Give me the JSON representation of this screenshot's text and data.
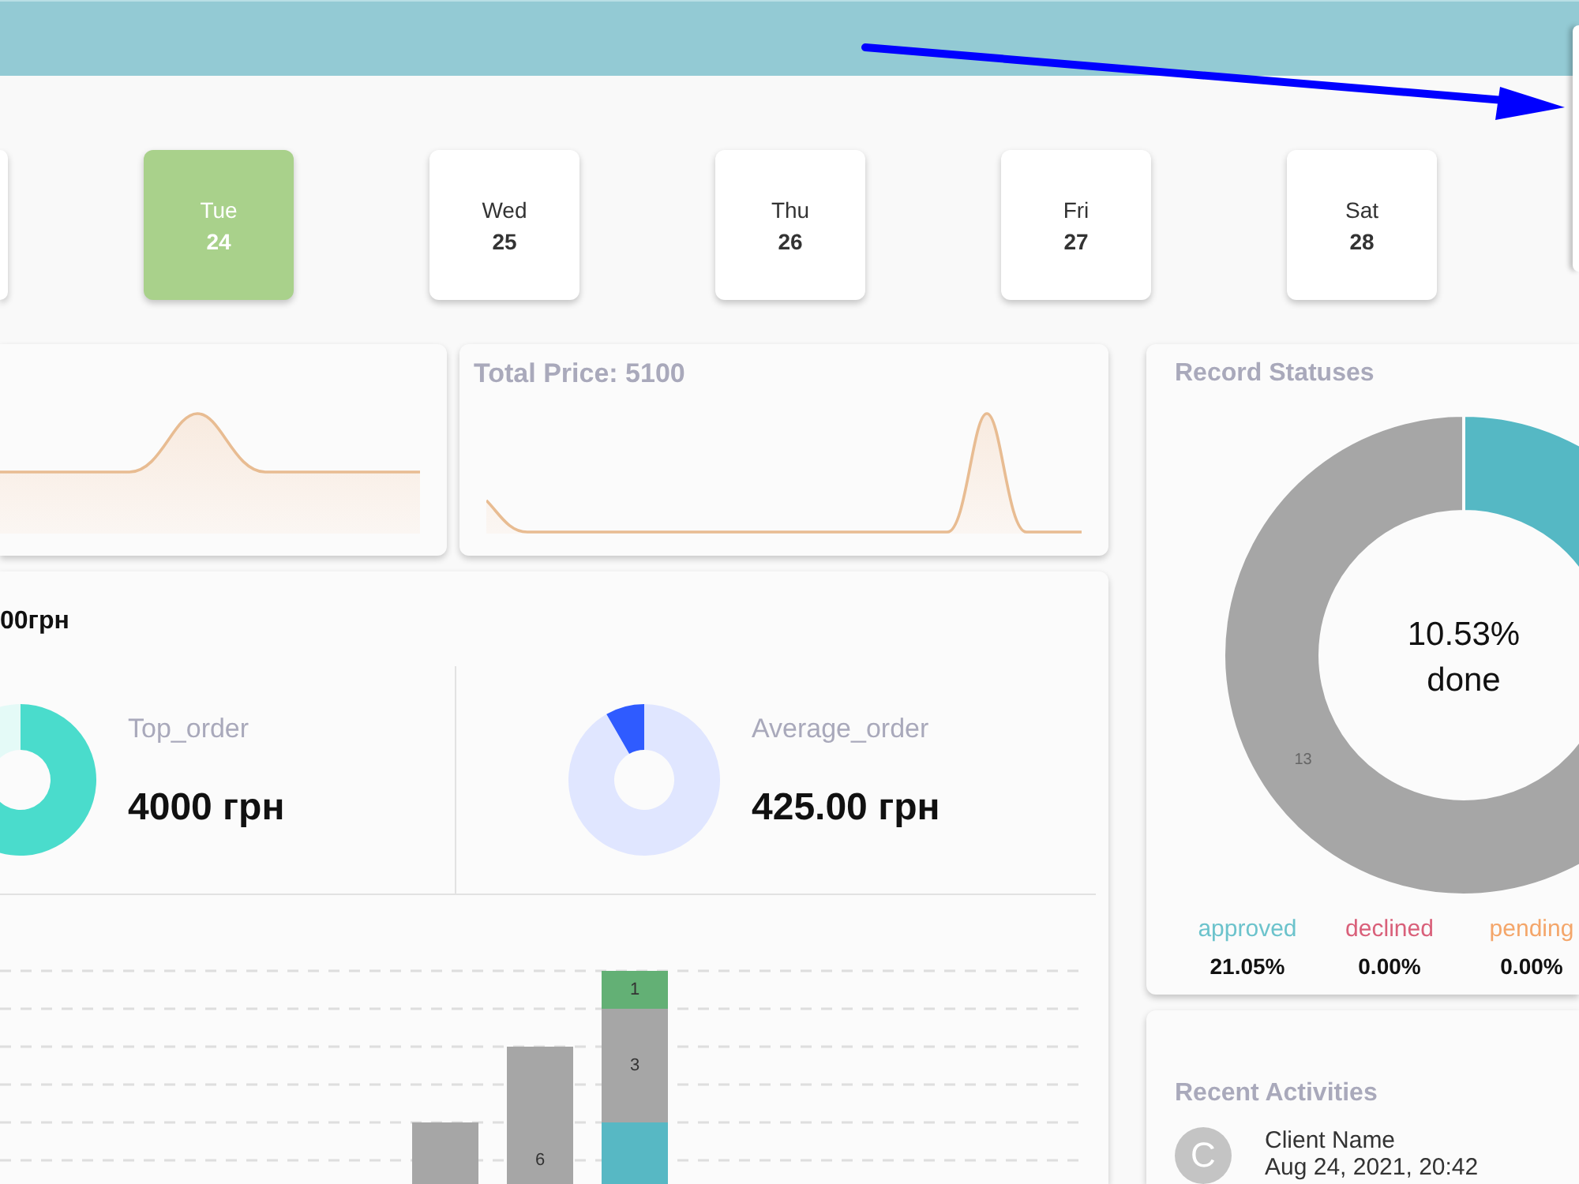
{
  "days": [
    {
      "selected": false
    },
    {
      "day": "Tue",
      "date": "24",
      "selected": true
    },
    {
      "day": "Wed",
      "date": "25",
      "selected": false
    },
    {
      "day": "Thu",
      "date": "26",
      "selected": false
    },
    {
      "day": "Fri",
      "date": "27",
      "selected": false
    },
    {
      "day": "Sat",
      "date": "28",
      "selected": false
    }
  ],
  "price_cards": [
    {
      "kind": "wide_peak"
    },
    {
      "kind": "late_peak",
      "title": "Total Price: 5100"
    }
  ],
  "orders": {
    "total": "00грн",
    "stats": [
      {
        "label": "Top_order",
        "value": "4000 грн",
        "color": "#4adccc"
      },
      {
        "label": "Average_order",
        "value": "425.00 грн",
        "color": "#2f5bff"
      }
    ],
    "chart": {
      "bars": [
        {
          "segments": [
            {
              "color": "#a6a6a6"
            }
          ]
        },
        {
          "segments": [
            {
              "color": "#a6a6a6",
              "label": "6"
            }
          ]
        },
        {
          "segments": [
            {
              "color": "#63b075",
              "label": "1"
            },
            {
              "color": "#a6a6a6",
              "label": "3"
            },
            {
              "color": "#57b8c4"
            }
          ]
        }
      ]
    }
  },
  "record_statuses": {
    "title": "Record Statuses",
    "center_value": "10.53%",
    "center_label": "done",
    "slices": [
      {
        "color": "#55b8c4"
      },
      {
        "color": "#a6a6a6",
        "label": "13"
      }
    ],
    "legend": [
      {
        "label": "approved",
        "value": "21.05%",
        "color": "#6cc3cc"
      },
      {
        "label": "declined",
        "value": "0.00%",
        "color": "#d9607a"
      },
      {
        "label": "pending",
        "value": "0.00%",
        "color": "#f4a66a"
      }
    ]
  },
  "recent_activities": {
    "title": "Recent Activities",
    "items": [
      {
        "initial": "C",
        "name": "Client Name",
        "time": "Aug 24, 2021, 20:42"
      }
    ]
  }
}
